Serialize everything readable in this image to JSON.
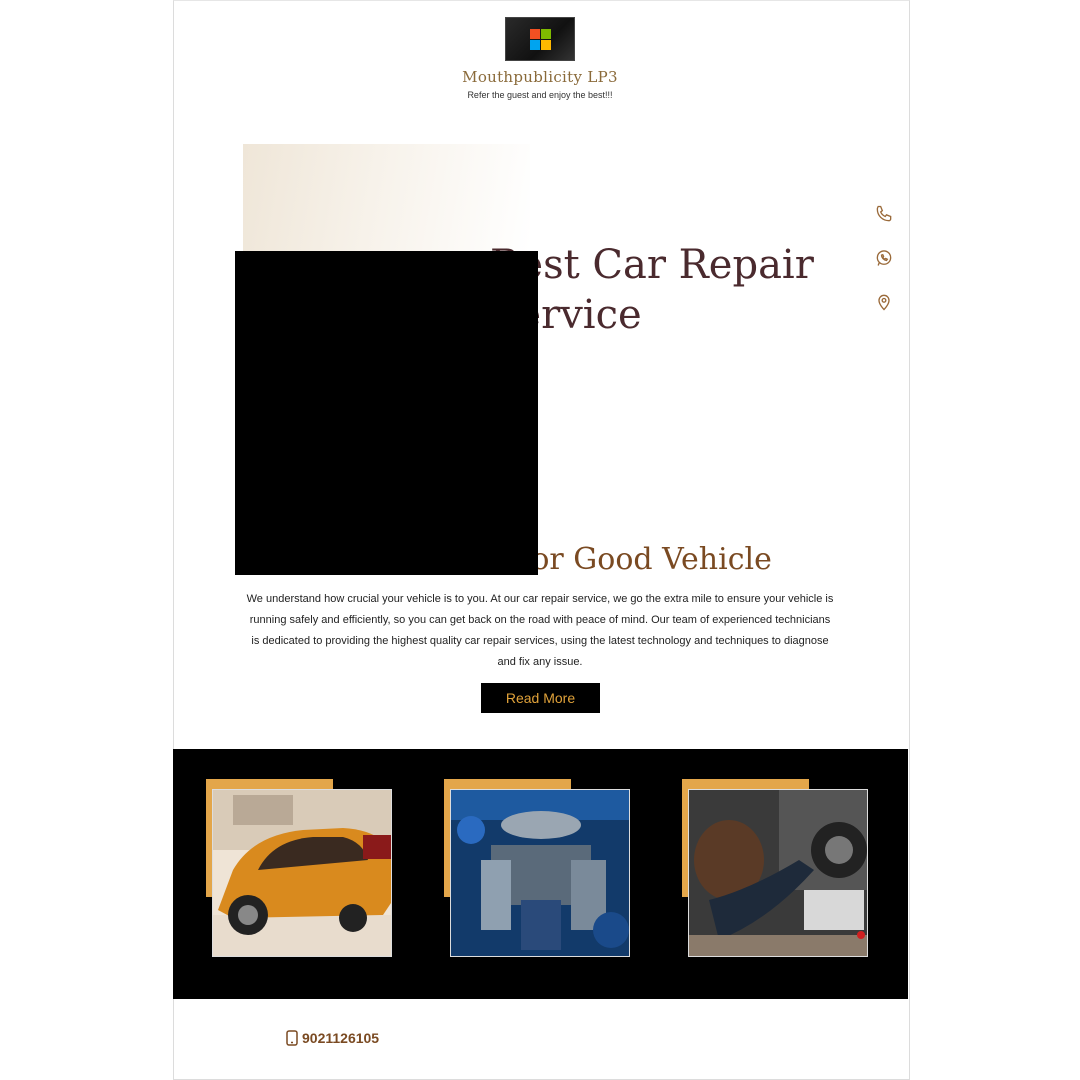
{
  "header": {
    "brand_name": "Mouthpublicity LP3",
    "tagline": "Refer the guest and enjoy the best!!!",
    "logo_icon": "windows-logo-icon"
  },
  "hero": {
    "title": "Best Car Repair Service"
  },
  "side_contacts": [
    {
      "icon": "phone-icon"
    },
    {
      "icon": "whatsapp-icon"
    },
    {
      "icon": "location-pin-icon"
    }
  ],
  "about": {
    "title": "Good Service for Good Vehicle",
    "paragraph": "We understand how crucial your vehicle is to you. At our car repair service, we go the extra mile to ensure your vehicle is running safely and efficiently, so you can get back on the road with peace of mind. Our team of experienced technicians is dedicated to providing the highest quality car repair services, using the latest technology and techniques to diagnose and fix any issue.",
    "cta_label": "Read More"
  },
  "gallery": [
    {
      "icon": "orange-sports-car-photo"
    },
    {
      "icon": "car-engine-photo"
    },
    {
      "icon": "mechanic-under-car-photo"
    }
  ],
  "footer": {
    "phone": "9021126105",
    "phone_icon": "mobile-phone-icon"
  },
  "colors": {
    "accent_gold": "#e3a64a",
    "brown_text": "#7a4a22",
    "hero_title": "#4a2a2e",
    "button_bg": "#000000",
    "button_text": "#e0a23a"
  }
}
